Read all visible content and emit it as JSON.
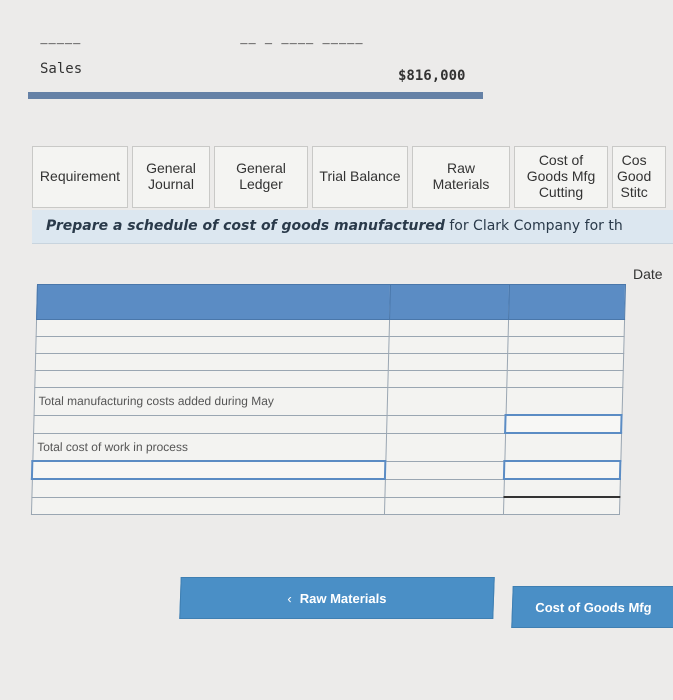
{
  "summary": {
    "sales_label": "Sales",
    "sales_value": "$816,000"
  },
  "tabs": [
    {
      "label": "Requirement"
    },
    {
      "label": "General\nJournal"
    },
    {
      "label": "General\nLedger"
    },
    {
      "label": "Trial Balance"
    },
    {
      "label": "Raw\nMaterials"
    },
    {
      "label": "Cost of\nGoods Mfg\nCutting"
    },
    {
      "label": "Cos\nGood\nStitc"
    }
  ],
  "instruction": {
    "lead": "Prepare a schedule of cost of goods manufactured",
    "rest": " for Clark Company for th"
  },
  "sheet": {
    "date_label": "Date",
    "total_mfg_costs_label": "Total manufacturing costs added during May",
    "total_wip_label": "Total cost of work in process"
  },
  "nav": {
    "prev_label": "Raw Materials",
    "next_label": "Cost of Goods Mfg"
  },
  "colors": {
    "accent": "#5b8cc4",
    "button": "#4a8fc6",
    "instruction_bg": "#dce7f0"
  }
}
